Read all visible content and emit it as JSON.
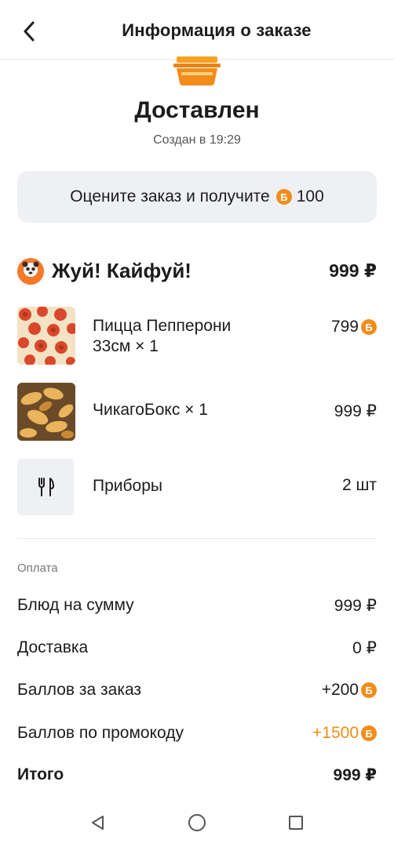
{
  "header": {
    "title": "Информация о заказе"
  },
  "status": {
    "title": "Доставлен",
    "created": "Создан в 19:29"
  },
  "rate": {
    "text": "Оцените заказ и получите",
    "bonus": "100",
    "coin_symbol": "Б"
  },
  "restaurant": {
    "name": "Жуй! Кайфуй!",
    "total": "999 ₽"
  },
  "items": [
    {
      "name": "Пицца Пепперони 33см × 1",
      "price": "799",
      "currency_icon": "bonus-coin"
    },
    {
      "name": "ЧикагоБокс × 1",
      "price": "999 ₽"
    },
    {
      "name": "Приборы",
      "price": "2 шт"
    }
  ],
  "payment": {
    "label": "Оплата",
    "rows": [
      {
        "label": "Блюд на сумму",
        "value": "999 ₽"
      },
      {
        "label": "Доставка",
        "value": "0 ₽"
      },
      {
        "label": "Баллов за заказ",
        "value": "+200"
      },
      {
        "label": "Баллов по промокоду",
        "value": "+1500"
      },
      {
        "label": "Итого",
        "value": "999 ₽"
      }
    ]
  },
  "colors": {
    "accent": "#f28c1a",
    "button_bg": "#eef0f3"
  }
}
